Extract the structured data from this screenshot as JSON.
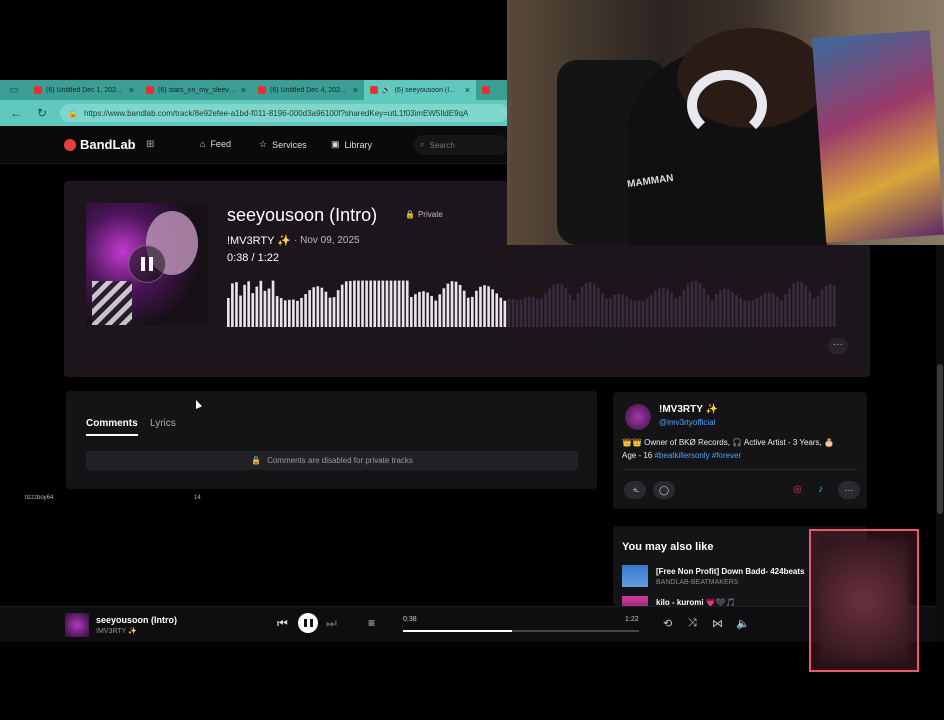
{
  "browser": {
    "tabs": [
      {
        "label": "(6) Untitled Dec 1, 202..."
      },
      {
        "label": "(6) stars_on_my_sleeve..."
      },
      {
        "label": "(6) Untitled Dec 4, 202..."
      },
      {
        "label": "(6) seeyousoon (I...",
        "active": true
      }
    ],
    "url": "https://www.bandlab.com/track/8e92efee-a1bd-f011-8196-000d3a96100f?sharedKey=utL1f03imEW5IldE9qA"
  },
  "header": {
    "brand": "BandLab",
    "nav": [
      {
        "label": "Feed",
        "icon": "home-icon"
      },
      {
        "label": "Services",
        "icon": "star-icon"
      },
      {
        "label": "Library",
        "icon": "library-icon"
      }
    ],
    "search_placeholder": "Search"
  },
  "track": {
    "title": "seeyousoon (Intro)",
    "visibility": "Private",
    "artist": "!MV3RTY ✨",
    "date": "· Nov 09, 2025",
    "time": "0:38 / 1:22",
    "progress_fraction": 0.46
  },
  "comments": {
    "tabs": [
      "Comments",
      "Lyrics"
    ],
    "active_tab": "Comments",
    "disabled_message": "Comments are disabled for private tracks"
  },
  "background_text": {
    "username": "tizzzboy64",
    "count": "14"
  },
  "artist_card": {
    "name": "!MV3RTY ✨",
    "handle": "@imv3rtyofficial",
    "bio_line1": "👑👑 Owner of BKØ Records, 🎧 Active Artist - 3 Years, 🎂",
    "bio_line2_prefix": "Age - 16",
    "bio_tags": "#beatkillersonly #forever"
  },
  "also_like": {
    "title": "You may also like",
    "items": [
      {
        "name": "[Free Non Profit] Down Badd- 424beats",
        "sub": "BANDLAB-BEATMAKERS"
      },
      {
        "name": "kilo - kuromi 💗🖤🎵",
        "sub": ""
      }
    ]
  },
  "player": {
    "title": "seeyousoon (Intro)",
    "artist": "!MV3RTY ✨",
    "current": "0:38",
    "duration": "1:22",
    "progress_fraction": 0.46
  },
  "webcam": {
    "shirt_text": "MAMMAN"
  },
  "colors": {
    "brand": "#e8413b",
    "link": "#4da3ff",
    "browser_teal": "#5fc9be",
    "recording_border": "#e45c6e"
  }
}
